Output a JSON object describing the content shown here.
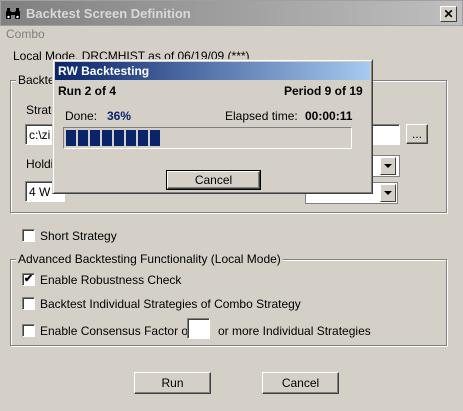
{
  "window": {
    "title": "Backtest Screen Definition",
    "close_label": "✕"
  },
  "menu": {
    "label": "Combo"
  },
  "info": "Local Mode. DRCMHIST as of 06/19/09 (***)",
  "backtest_group": {
    "label_partial": "Backte",
    "strategy_label_partial": "Strate",
    "path_value_partial": "c:\\zi",
    "holding_label_partial": "Holdi",
    "holding_value_partial": "4 W",
    "browse_label": "..."
  },
  "short_strategy": {
    "label": "Short Strategy",
    "checked": false
  },
  "advanced": {
    "label": "Advanced Backtesting Functionality (Local Mode)",
    "robustness": {
      "label": "Enable Robustness Check",
      "checked": true
    },
    "individual": {
      "label": "Backtest Individual Strategies of Combo Strategy",
      "checked": false
    },
    "consensus": {
      "label": "Enable Consensus Factor of",
      "value": "",
      "suffix": "or more Individual Strategies",
      "checked": false
    }
  },
  "buttons": {
    "run": "Run",
    "cancel": "Cancel"
  },
  "progress_dialog": {
    "title": "RW Backtesting",
    "run_text": "Run 2 of 4",
    "period_text": "Period 9 of 19",
    "done_label": "Done:",
    "done_value": "36%",
    "elapsed_label": "Elapsed time:",
    "elapsed_value": "00:00:11",
    "progress_fraction": 0.36,
    "cancel_label": "Cancel"
  },
  "colors": {
    "accent": "#0a246a",
    "face": "#d4d0c8"
  }
}
